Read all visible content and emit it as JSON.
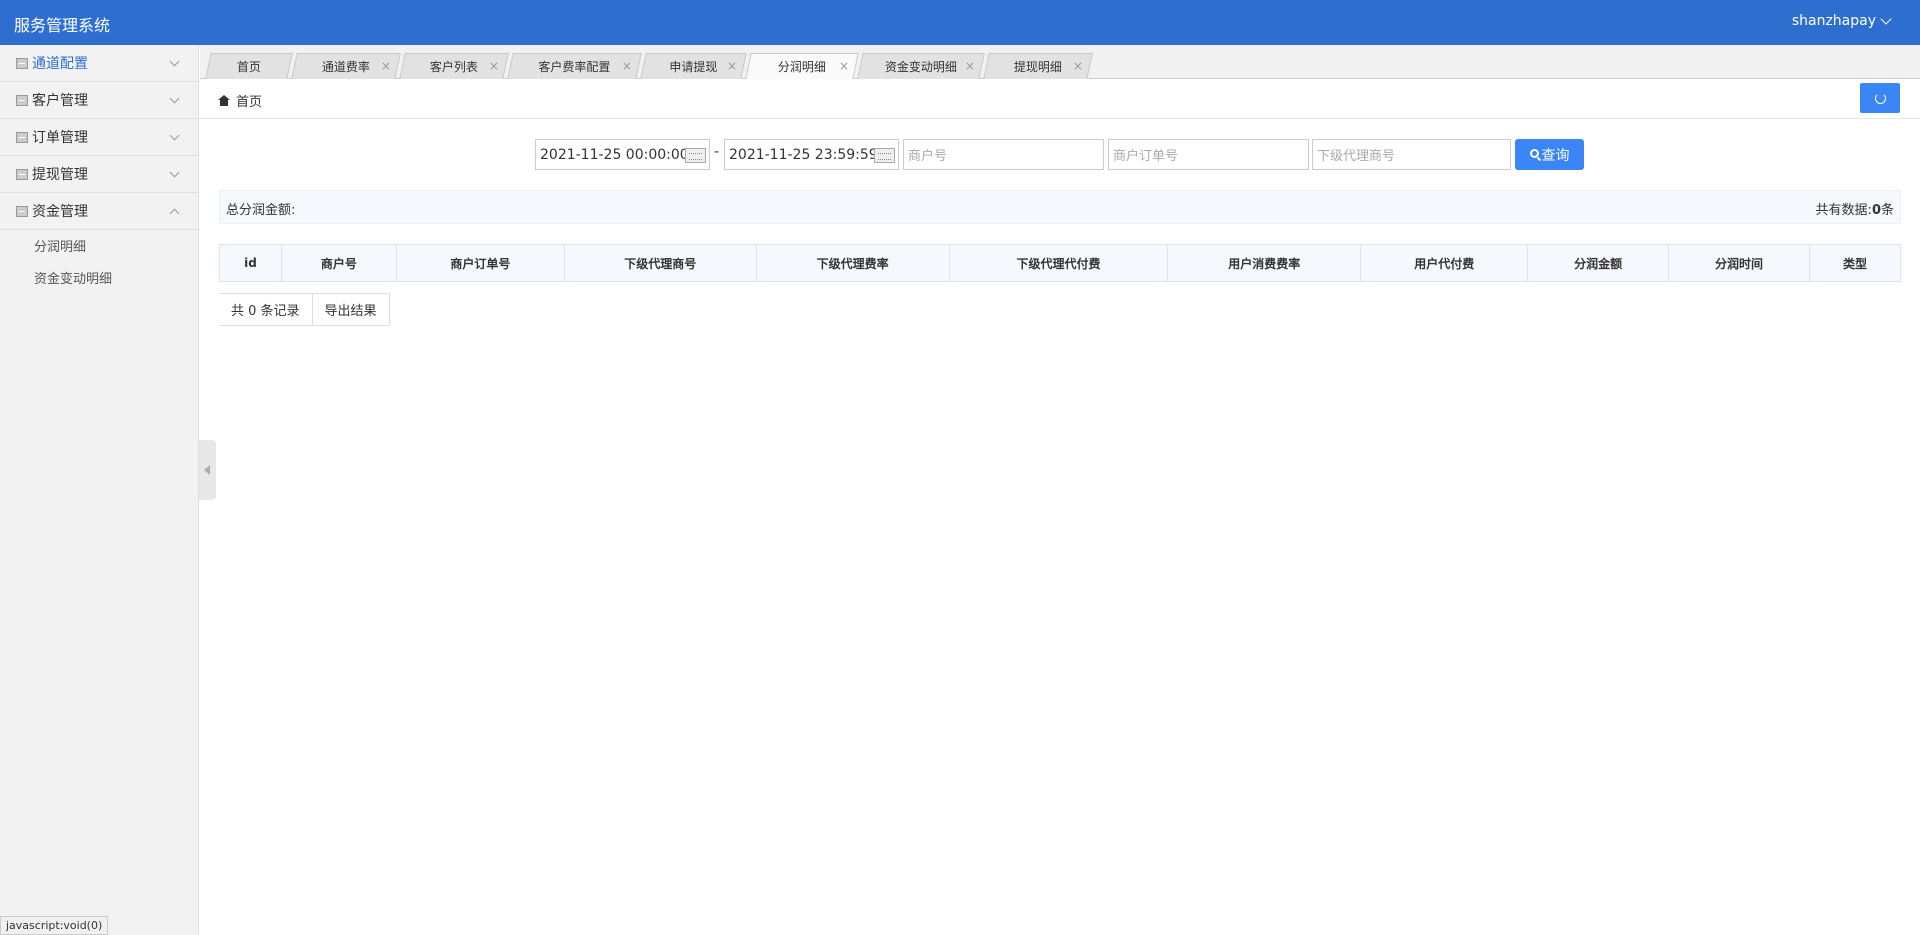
{
  "app": {
    "title": "服务管理系统",
    "user": "shanzhapay"
  },
  "sidebar": {
    "items": [
      {
        "label": "通道配置"
      },
      {
        "label": "客户管理"
      },
      {
        "label": "订单管理"
      },
      {
        "label": "提现管理"
      },
      {
        "label": "资金管理"
      }
    ],
    "sub_items": [
      {
        "label": "分润明细"
      },
      {
        "label": "资金变动明细"
      }
    ],
    "status_link": "javascript:void(0)"
  },
  "tabs": [
    {
      "label": "首页"
    },
    {
      "label": "通道费率"
    },
    {
      "label": "客户列表"
    },
    {
      "label": "客户费率配置"
    },
    {
      "label": "申请提现"
    },
    {
      "label": "分润明细"
    },
    {
      "label": "资金变动明细"
    },
    {
      "label": "提现明细"
    }
  ],
  "tab_close": "×",
  "breadcrumb": "首页",
  "filters": {
    "start_time": "2021-11-25 00:00:00",
    "separator": "-",
    "end_time": "2021-11-25 23:59:59",
    "merchant_no_placeholder": "商户号",
    "merchant_order_placeholder": "商户订单号",
    "sub_agent_placeholder": "下级代理商号",
    "query_label": "查询"
  },
  "summary": {
    "total_label": "总分润金额:",
    "count_label": "共有数据:",
    "count_value": "0",
    "count_unit": "条"
  },
  "table": {
    "headers": [
      "id",
      "商户号",
      "商户订单号",
      "下级代理商号",
      "下级代理费率",
      "下级代理代付费",
      "用户消费费率",
      "用户代付费",
      "分润金额",
      "分润时间",
      "类型"
    ]
  },
  "footer": {
    "records": "共 0 条记录",
    "export": "导出结果"
  }
}
